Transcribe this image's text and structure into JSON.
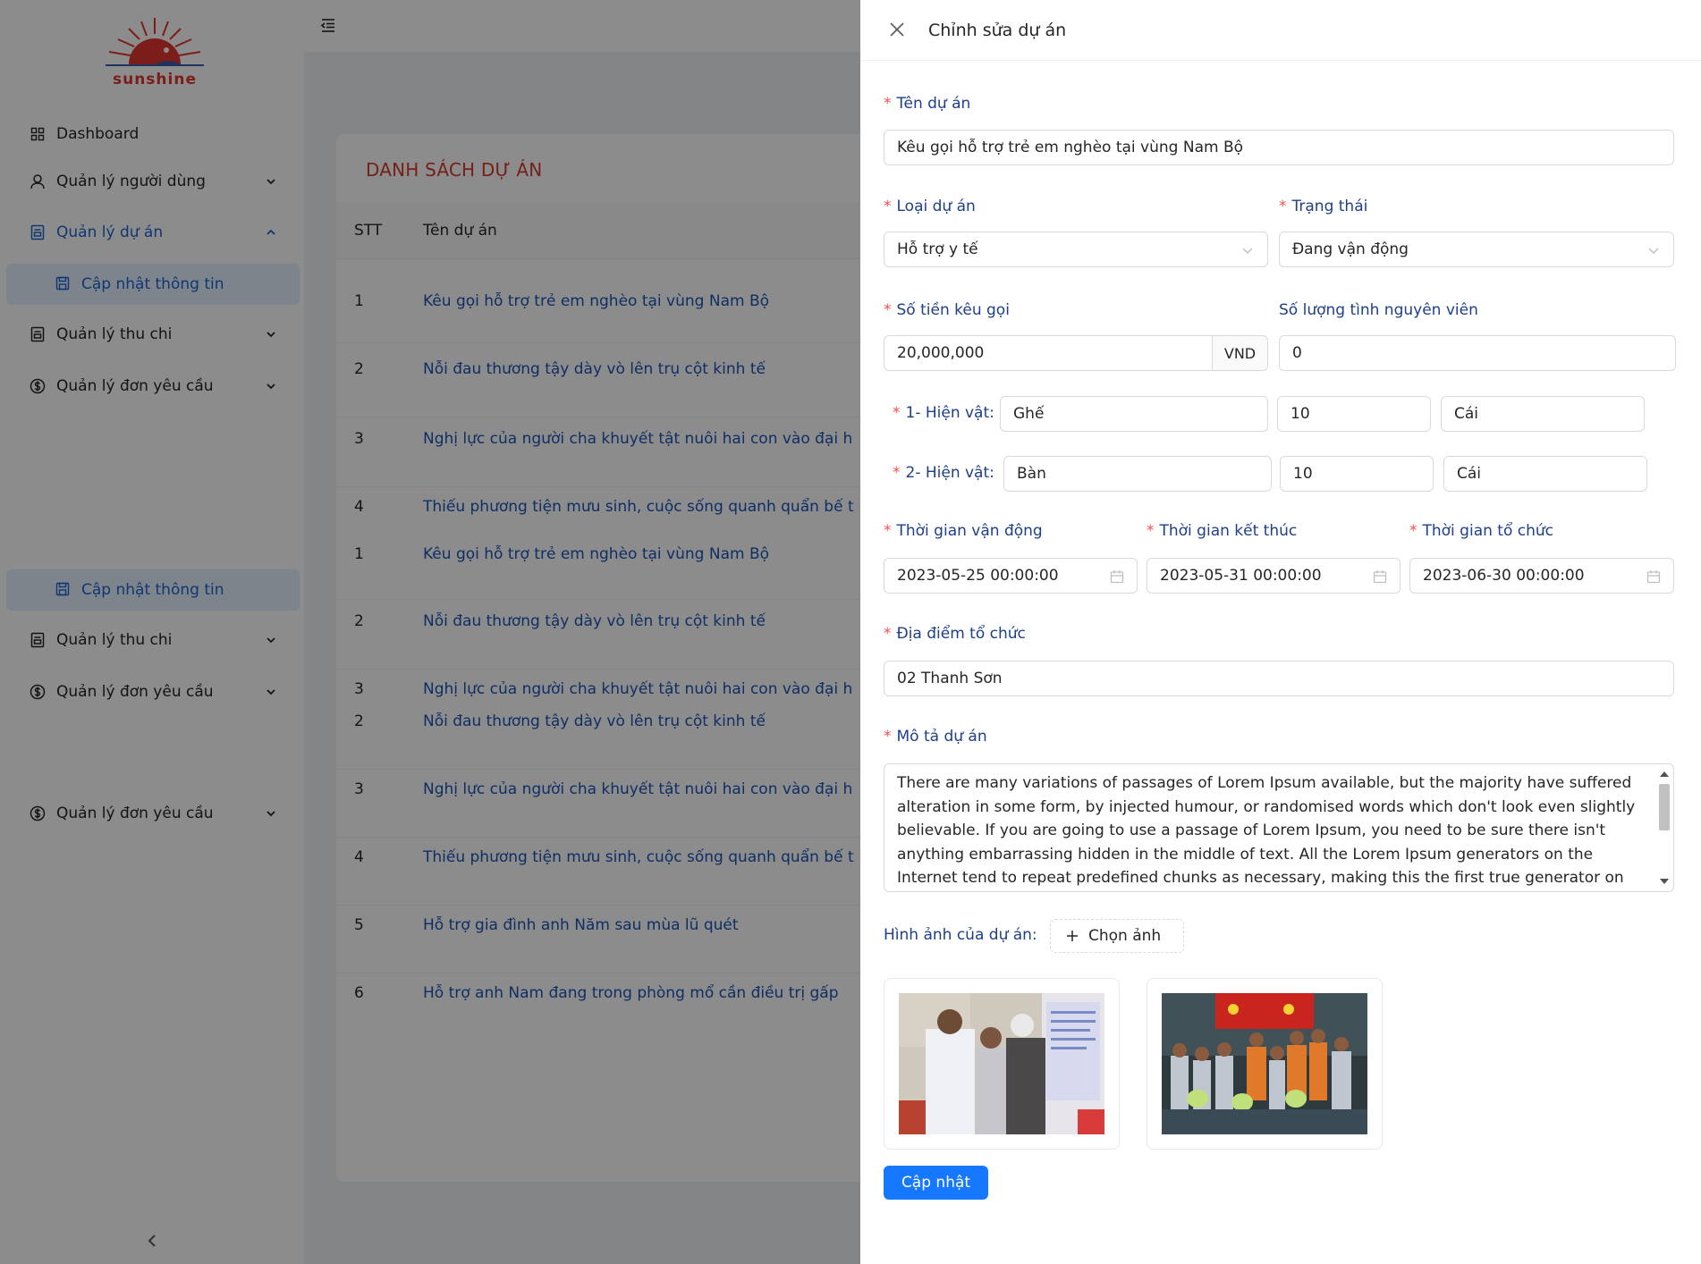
{
  "sidebar": {
    "logo_text": "sunshine",
    "menu": {
      "dashboard": "Dashboard",
      "users": "Quản lý người dùng",
      "projects": "Quản lý dự án",
      "projects_sub": "Cập nhật thông tin",
      "finance": "Quản lý thu chi",
      "requests": "Quản lý đơn yêu cầu",
      "sub_dup": "Cập nhật thông tin",
      "finance_dup": "Quản lý thu chi",
      "requests_dup": "Quản lý đơn yêu cầu",
      "requests_dup2": "Quản lý đơn yêu cầu"
    }
  },
  "card": {
    "title": "DANH SÁCH DỰ ÁN",
    "columns": {
      "stt": "STT",
      "name": "Tên dự án"
    },
    "rows": [
      {
        "no": "1",
        "name": "Kêu gọi hỗ trợ trẻ em nghèo tại vùng Nam Bộ"
      },
      {
        "no": "2",
        "name": "Nỗi đau thương tậy dày vò lên trụ cột kinh tế"
      },
      {
        "no": "3",
        "name": "Nghị lực của người cha khuyết tật nuôi hai con vào đại h"
      },
      {
        "no": "4",
        "name": "Thiếu phương tiện mưu sinh, cuộc sống quanh quẩn bế t"
      },
      {
        "no": "1",
        "name": "Kêu gọi hỗ trợ trẻ em nghèo tại vùng Nam Bộ"
      },
      {
        "no": "2",
        "name": "Nỗi đau thương tậy dày vò lên trụ cột kinh tế"
      },
      {
        "no": "3",
        "name": "Nghị lực của người cha khuyết tật nuôi hai con vào đại h"
      },
      {
        "no": "2",
        "name": "Nỗi đau thương tậy dày vò lên trụ cột kinh tế"
      },
      {
        "no": "3",
        "name": "Nghị lực của người cha khuyết tật nuôi hai con vào đại h"
      },
      {
        "no": "4",
        "name": "Thiếu phương tiện mưu sinh, cuộc sống quanh quẩn bế t"
      },
      {
        "no": "5",
        "name": "Hỗ trợ gia đình anh Năm sau mùa lũ quét"
      },
      {
        "no": "6",
        "name": "Hỗ trợ anh Nam đang trong phòng mổ cần điều trị gấp"
      }
    ]
  },
  "drawer": {
    "title": "Chỉnh sửa dự án",
    "req": "*",
    "project_name": {
      "label": "Tên dự án",
      "value": "Kêu gọi hỗ trợ trẻ em nghèo tại vùng Nam Bộ"
    },
    "project_type": {
      "label": "Loại dự án",
      "value": "Hỗ trợ y tế"
    },
    "status": {
      "label": "Trạng thái",
      "value": "Đang vận động"
    },
    "amount": {
      "label": "Số tiền kêu gọi",
      "value": "20,000,000",
      "suffix": "VND"
    },
    "volunteers": {
      "label": "Số lượng tình nguyên viên",
      "value": "0"
    },
    "items": [
      {
        "label": "1- Hiện vật:",
        "name": "Ghế",
        "qty": "10",
        "unit": "Cái"
      },
      {
        "label": "2- Hiện vật:",
        "name": "Bàn",
        "qty": "10",
        "unit": "Cái"
      }
    ],
    "campaign_time": {
      "label": "Thời gian vận động",
      "value": "2023-05-25 00:00:00"
    },
    "end_time": {
      "label": "Thời gian kết thúc",
      "value": "2023-05-31 00:00:00"
    },
    "event_time": {
      "label": "Thời gian tổ chức",
      "value": "2023-06-30 00:00:00"
    },
    "location": {
      "label": "Địa điểm tổ chức",
      "value": "02 Thanh Sơn"
    },
    "description": {
      "label": "Mô tả dự án",
      "value": "There are many variations of passages of Lorem Ipsum available, but the majority have suffered alteration in some form, by injected humour, or randomised words which don't look even slightly believable. If you are going to use a passage of Lorem Ipsum, you need to be sure there isn't anything embarrassing hidden in the middle of text. All the Lorem Ipsum generators on the Internet tend to repeat predefined chunks as necessary, making this the first true generator on the"
    },
    "images": {
      "label": "Hình ảnh của dự án:",
      "button": "Chọn ảnh"
    },
    "submit": "Cập nhật"
  }
}
